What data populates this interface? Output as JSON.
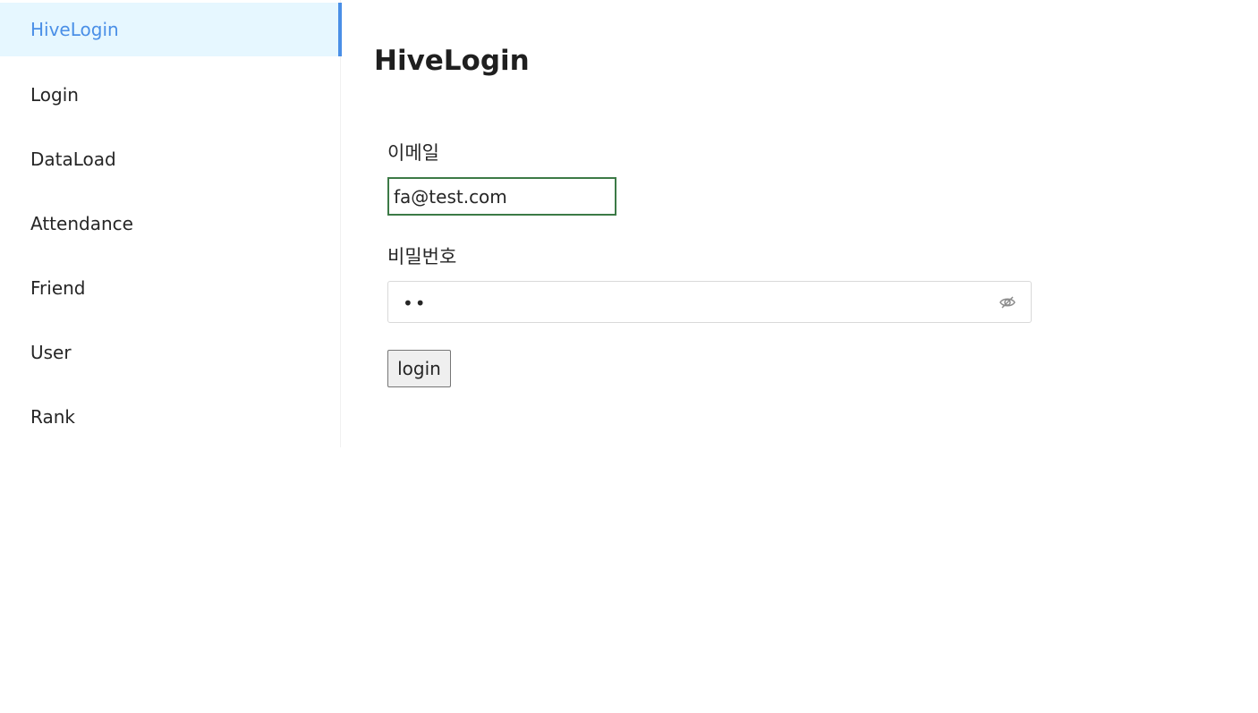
{
  "sidebar": {
    "items": [
      {
        "label": "HiveLogin",
        "active": true
      },
      {
        "label": "Login",
        "active": false
      },
      {
        "label": "DataLoad",
        "active": false
      },
      {
        "label": "Attendance",
        "active": false
      },
      {
        "label": "Friend",
        "active": false
      },
      {
        "label": "User",
        "active": false
      },
      {
        "label": "Rank",
        "active": false
      }
    ]
  },
  "main": {
    "title": "HiveLogin",
    "email": {
      "label": "이메일",
      "value": "fa@test.com"
    },
    "password": {
      "label": "비밀번호",
      "value": "••",
      "toggle_icon": "eye-invisible-icon"
    },
    "login_label": "login"
  },
  "colors": {
    "accent": "#4a8fe7",
    "active_bg": "#e6f7ff",
    "focus_border": "#3c7a46"
  }
}
